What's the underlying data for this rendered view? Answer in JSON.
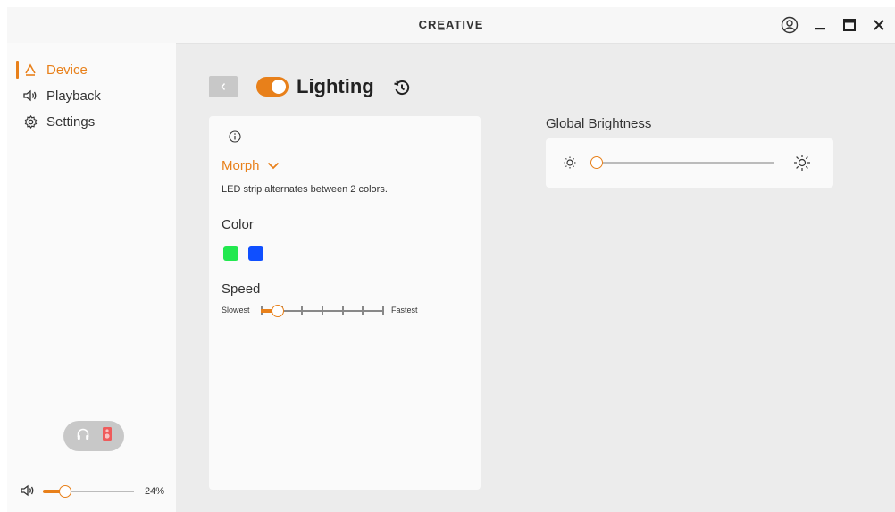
{
  "titlebar": {
    "brand": "CRE̲ATIVE",
    "icons": [
      "account-icon",
      "minimize-icon",
      "maximize-icon",
      "close-icon"
    ]
  },
  "sidebar": {
    "items": [
      {
        "label": "Device",
        "icon": "device-icon",
        "active": true
      },
      {
        "label": "Playback",
        "icon": "speaker-icon",
        "active": false
      },
      {
        "label": "Settings",
        "icon": "gear-icon",
        "active": false
      }
    ],
    "output_toggle": {
      "icons": [
        "headphones-icon",
        "speaker-box-icon"
      ],
      "selected": "speaker"
    },
    "volume": {
      "value": "24%",
      "level": 0.24
    }
  },
  "header": {
    "title": "Lighting",
    "enabled": true
  },
  "lighting": {
    "mode": "Morph",
    "description": "LED strip alternates between 2 colors.",
    "color_label": "Color",
    "colors": [
      "#22e84f",
      "#0f4fff"
    ],
    "speed_label": "Speed",
    "speed_min": "Slowest",
    "speed_max": "Fastest",
    "speed_level": 0,
    "speed_steps": 7
  },
  "brightness": {
    "label": "Global Brightness",
    "level": 0
  },
  "colors": {
    "accent": "#e8801a",
    "window_bg": "#ececec",
    "card_bg": "#fafafa"
  }
}
